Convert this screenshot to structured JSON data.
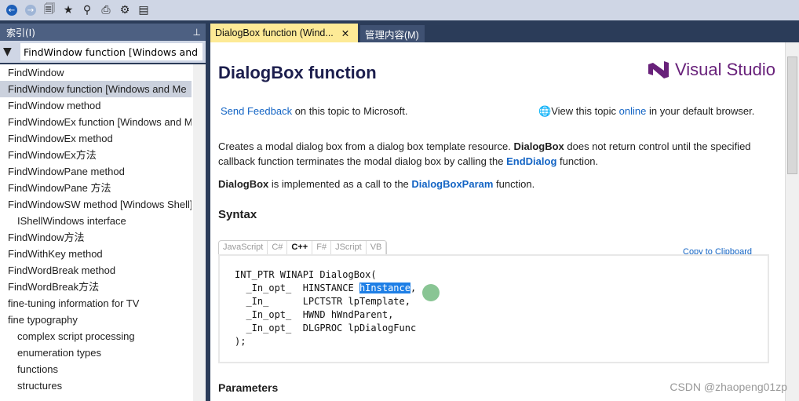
{
  "toolbar": {
    "icons": [
      "back-icon",
      "forward-icon",
      "sync-contents-icon",
      "add-favorite-icon",
      "search-icon",
      "print-icon",
      "settings-icon",
      "library-icon"
    ]
  },
  "index_panel": {
    "title": "索引(I)",
    "filter_value": "FindWindow function [Windows and",
    "items": [
      {
        "label": "FindWindow",
        "indent": false
      },
      {
        "label": "FindWindow function [Windows and Me",
        "indent": false,
        "selected": true
      },
      {
        "label": "FindWindow method",
        "indent": false
      },
      {
        "label": "FindWindowEx function [Windows and M",
        "indent": false
      },
      {
        "label": "FindWindowEx method",
        "indent": false
      },
      {
        "label": "FindWindowEx方法",
        "indent": false
      },
      {
        "label": "FindWindowPane method",
        "indent": false
      },
      {
        "label": "FindWindowPane 方法",
        "indent": false
      },
      {
        "label": "FindWindowSW method [Windows Shell]",
        "indent": false
      },
      {
        "label": "IShellWindows interface",
        "indent": true
      },
      {
        "label": "FindWindow方法",
        "indent": false
      },
      {
        "label": "FindWithKey method",
        "indent": false
      },
      {
        "label": "FindWordBreak method",
        "indent": false
      },
      {
        "label": "FindWordBreak方法",
        "indent": false
      },
      {
        "label": "fine-tuning information for TV",
        "indent": false
      },
      {
        "label": "fine typography",
        "indent": false
      },
      {
        "label": "complex script processing",
        "indent": true
      },
      {
        "label": "enumeration types",
        "indent": true
      },
      {
        "label": "functions",
        "indent": true
      },
      {
        "label": "structures",
        "indent": true
      }
    ]
  },
  "tabs": [
    {
      "label": "DialogBox function (Wind...",
      "active": true
    },
    {
      "label": "管理内容(M)",
      "active": false
    }
  ],
  "doc": {
    "title": "DialogBox function",
    "logo": "Visual Studio",
    "feedback_link": "Send Feedback",
    "feedback_rest": " on this topic to Microsoft.",
    "online_pre": "View this topic ",
    "online_link": "online",
    "online_post": " in your default browser.",
    "p1_a": "Creates a modal dialog box from a dialog box template resource. ",
    "p1_b": "DialogBox",
    "p1_c": " does not return control until the specified callback function terminates the modal dialog box by calling the ",
    "p1_d": "EndDialog",
    "p1_e": " function.",
    "p2_a": "DialogBox",
    "p2_b": " is implemented as a call to the ",
    "p2_c": "DialogBoxParam",
    "p2_d": " function.",
    "syntax_heading": "Syntax",
    "languages": [
      "JavaScript",
      "C#",
      "C++",
      "F#",
      "JScript",
      "VB"
    ],
    "selected_language": "C++",
    "copy_label": "Copy to Clipboard",
    "code_l1": "INT_PTR WINAPI DialogBox(\n  _In_opt_  HINSTANCE ",
    "code_sel": "hInstance",
    "code_l2": ",\n  _In_      LPCTSTR lpTemplate,\n  _In_opt_  HWND hWndParent,\n  _In_opt_  DLGPROC lpDialogFunc\n);",
    "parameters_heading": "Parameters"
  },
  "watermark": "CSDN @zhaopeng01zp"
}
